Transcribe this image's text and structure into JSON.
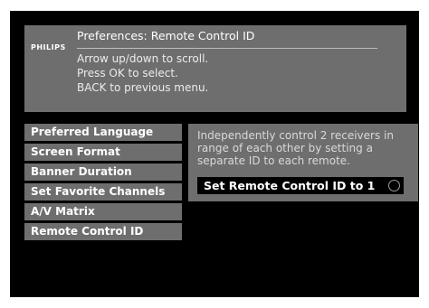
{
  "header": {
    "brand": "PHILIPS",
    "title": "Preferences: Remote Control ID",
    "instructions": [
      "Arrow up/down to scroll.",
      "Press OK to select.",
      "BACK to previous menu."
    ]
  },
  "menu": {
    "items": [
      {
        "label": "Preferred Language"
      },
      {
        "label": "Screen Format"
      },
      {
        "label": "Banner Duration"
      },
      {
        "label": "Set Favorite Channels"
      },
      {
        "label": "A/V Matrix"
      },
      {
        "label": "Remote Control ID"
      }
    ],
    "selected": "Remote Control ID"
  },
  "detail": {
    "description": "Independently control 2 receivers in range of each other by setting a separate ID to each remote.",
    "option": {
      "label": "Set Remote Control ID to 1",
      "icon": "radio-unselected-icon",
      "checked": false
    }
  },
  "colors": {
    "background": "#000000",
    "panel": "#6e6e6e",
    "text": "#ffffff",
    "muted_text": "#d9d9d9"
  }
}
